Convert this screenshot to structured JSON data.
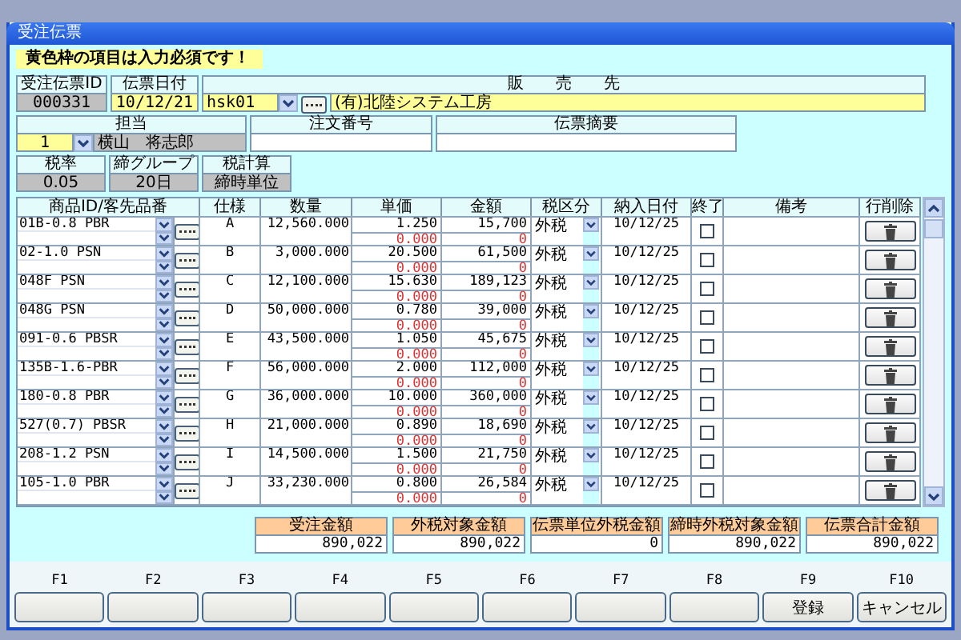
{
  "window": {
    "title": "受注伝票"
  },
  "notice": "黄色枠の項目は入力必須です！",
  "order_id": {
    "label": "受注伝票ID",
    "value": "000331"
  },
  "slip_date": {
    "label": "伝票日付",
    "value": "10/12/21"
  },
  "customer": {
    "label": "販　　売　　先",
    "code": "hsk01",
    "name": "(有)北陸システム工房"
  },
  "staff": {
    "label": "担当",
    "code": "1",
    "name": "横山　将志郎"
  },
  "order_number": {
    "label": "注文番号"
  },
  "slip_summary": {
    "label": "伝票摘要"
  },
  "tax_rate": {
    "label": "税率",
    "value": "0.05"
  },
  "closing_group": {
    "label": "締グループ",
    "value": "20日"
  },
  "tax_calc": {
    "label": "税計算",
    "value": "締時単位"
  },
  "table": {
    "columns": [
      "商品ID/客先品番",
      "仕様",
      "数量",
      "単価",
      "金額",
      "税区分",
      "納入日付",
      "終了",
      "備考",
      "行削除"
    ],
    "rows": [
      {
        "product": "01B-0.8 PBR",
        "spec": "A",
        "quantity": "12,560.000",
        "unit_price": "1.250",
        "unit_price_alt": "0.000",
        "amount": "15,700",
        "amount_alt": "0",
        "tax": "外税",
        "delivery_date": "10/12/25",
        "completed": false
      },
      {
        "product": "02-1.0 PSN",
        "spec": "B",
        "quantity": "3,000.000",
        "unit_price": "20.500",
        "unit_price_alt": "0.000",
        "amount": "61,500",
        "amount_alt": "0",
        "tax": "外税",
        "delivery_date": "10/12/25",
        "completed": false
      },
      {
        "product": "048F PSN",
        "spec": "C",
        "quantity": "12,100.000",
        "unit_price": "15.630",
        "unit_price_alt": "0.000",
        "amount": "189,123",
        "amount_alt": "0",
        "tax": "外税",
        "delivery_date": "10/12/25",
        "completed": false
      },
      {
        "product": "048G PSN",
        "spec": "D",
        "quantity": "50,000.000",
        "unit_price": "0.780",
        "unit_price_alt": "0.000",
        "amount": "39,000",
        "amount_alt": "0",
        "tax": "外税",
        "delivery_date": "10/12/25",
        "completed": false
      },
      {
        "product": "091-0.6 PBSR",
        "spec": "E",
        "quantity": "43,500.000",
        "unit_price": "1.050",
        "unit_price_alt": "0.000",
        "amount": "45,675",
        "amount_alt": "0",
        "tax": "外税",
        "delivery_date": "10/12/25",
        "completed": false
      },
      {
        "product": "135B-1.6-PBR",
        "spec": "F",
        "quantity": "56,000.000",
        "unit_price": "2.000",
        "unit_price_alt": "0.000",
        "amount": "112,000",
        "amount_alt": "0",
        "tax": "外税",
        "delivery_date": "10/12/25",
        "completed": false
      },
      {
        "product": "180-0.8 PBR",
        "spec": "G",
        "quantity": "36,000.000",
        "unit_price": "10.000",
        "unit_price_alt": "0.000",
        "amount": "360,000",
        "amount_alt": "0",
        "tax": "外税",
        "delivery_date": "10/12/25",
        "completed": false
      },
      {
        "product": "527(0.7) PBSR",
        "spec": "H",
        "quantity": "21,000.000",
        "unit_price": "0.890",
        "unit_price_alt": "0.000",
        "amount": "18,690",
        "amount_alt": "0",
        "tax": "外税",
        "delivery_date": "10/12/25",
        "completed": false
      },
      {
        "product": "208-1.2 PSN",
        "spec": "I",
        "quantity": "14,500.000",
        "unit_price": "1.500",
        "unit_price_alt": "0.000",
        "amount": "21,750",
        "amount_alt": "0",
        "tax": "外税",
        "delivery_date": "10/12/25",
        "completed": false
      },
      {
        "product": "105-1.0 PBR",
        "spec": "J",
        "quantity": "33,230.000",
        "unit_price": "0.800",
        "unit_price_alt": "0.000",
        "amount": "26,584",
        "amount_alt": "0",
        "tax": "外税",
        "delivery_date": "10/12/25",
        "completed": false
      }
    ]
  },
  "totals": [
    {
      "label": "受注金額",
      "value": "890,022"
    },
    {
      "label": "外税対象金額",
      "value": "890,022"
    },
    {
      "label": "伝票単位外税金額",
      "value": "0"
    },
    {
      "label": "締時外税対象金額",
      "value": "890,022"
    },
    {
      "label": "伝票合計金額",
      "value": "890,022"
    }
  ],
  "function_keys": [
    {
      "key": "F1"
    },
    {
      "key": "F2"
    },
    {
      "key": "F3"
    },
    {
      "key": "F4"
    },
    {
      "key": "F5"
    },
    {
      "key": "F6"
    },
    {
      "key": "F7"
    },
    {
      "key": "F8"
    },
    {
      "key": "F9",
      "label": "登録"
    },
    {
      "key": "F10",
      "label": "キャンセル"
    }
  ]
}
